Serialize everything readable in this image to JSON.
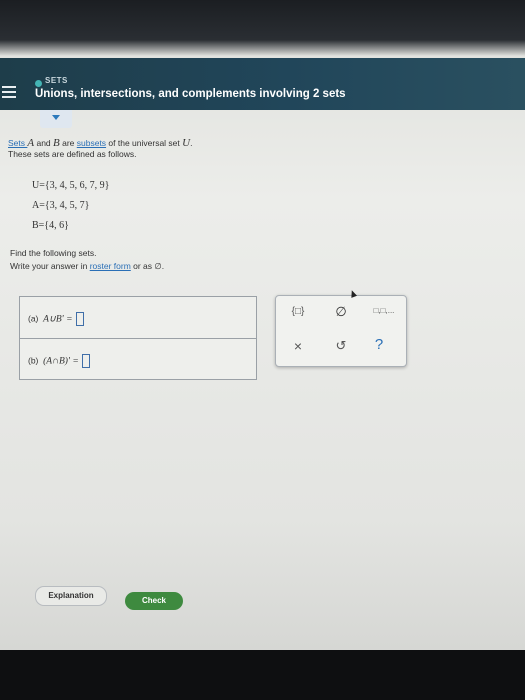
{
  "header": {
    "topic": "SETS",
    "title": "Unions, intersections, and complements involving 2 sets"
  },
  "problem": {
    "line1_pre": "Sets ",
    "set_a": "A",
    "and": " and ",
    "set_b": "B",
    "are": " are ",
    "subsets_link": "subsets",
    "line1_post": " of the universal set ",
    "universal": "U",
    "period": ".",
    "line2": "These sets are defined as follows.",
    "sets": [
      "U={3, 4, 5, 6, 7, 9}",
      "A={3, 4, 5, 7}",
      "B={4, 6}"
    ],
    "instruction1": "Find the following sets.",
    "instruction2_pre": "Write your answer in ",
    "roster_link": "roster form",
    "instruction2_post": " or as ∅."
  },
  "answers": [
    {
      "label": "(a)",
      "expr": "A∪B' ="
    },
    {
      "label": "(b)",
      "expr": "(A∩B)' ="
    }
  ],
  "palette": {
    "set_braces": "{□}",
    "empty_set": "∅",
    "list": "□,□,...",
    "clear": "×",
    "undo": "↺",
    "help": "?"
  },
  "buttons": {
    "explanation": "Explanation",
    "check": "Check"
  },
  "colors": {
    "header": "#21465a",
    "link": "#2a6fb6",
    "check": "#3e8a3f"
  }
}
